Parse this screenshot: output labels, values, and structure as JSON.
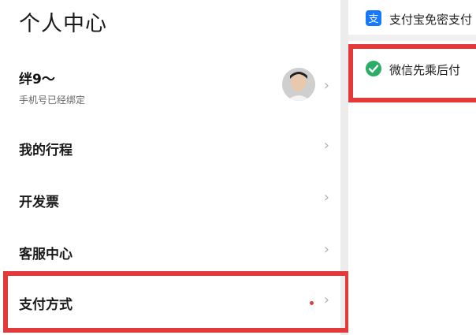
{
  "page_title": "个人中心",
  "profile": {
    "name": "绊9～",
    "subtitle": "手机号已经绑定",
    "chevron": "›"
  },
  "menu": [
    {
      "label": "我的行程",
      "chevron": "›"
    },
    {
      "label": "开发票",
      "chevron": "›"
    },
    {
      "label": "客服中心",
      "chevron": "›"
    },
    {
      "label": "支付方式",
      "chevron": "›",
      "has_red_dot": true
    }
  ],
  "payment_methods": [
    {
      "label": "支付宝免密支付",
      "icon": "alipay-icon",
      "color": "#1677ff"
    },
    {
      "label": "微信先乘后付",
      "icon": "wechat-pay-icon",
      "color": "#2aae67"
    }
  ],
  "colors": {
    "highlight": "#e23a3a",
    "red_dot": "#e0403a",
    "chevron": "#b0b0b0"
  }
}
